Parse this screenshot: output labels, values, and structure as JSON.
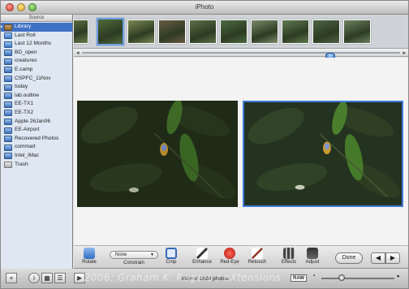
{
  "window": {
    "title": "iPhoto"
  },
  "source": {
    "header": "Source",
    "items": [
      {
        "label": "Library",
        "icon": "library-icon",
        "selected": true
      },
      {
        "label": "Last Roll",
        "icon": "roll-icon"
      },
      {
        "label": "Last 12 Months",
        "icon": "roll-icon"
      },
      {
        "label": "BD_open",
        "icon": "album-icon"
      },
      {
        "label": "creatures",
        "icon": "album-icon"
      },
      {
        "label": "E.camp",
        "icon": "album-icon"
      },
      {
        "label": "CSPFC_11Nov",
        "icon": "album-icon"
      },
      {
        "label": "today",
        "icon": "album-icon"
      },
      {
        "label": "lab.outline",
        "icon": "album-icon"
      },
      {
        "label": "EE-TX1",
        "icon": "album-icon"
      },
      {
        "label": "EE-TX2",
        "icon": "album-icon"
      },
      {
        "label": "Apple 26Jan06",
        "icon": "album-icon"
      },
      {
        "label": "EE-Airport",
        "icon": "album-icon"
      },
      {
        "label": "Recovered Photos",
        "icon": "album-icon"
      },
      {
        "label": "commart",
        "icon": "album-icon"
      },
      {
        "label": "Intel_iMac",
        "icon": "album-icon"
      },
      {
        "label": "Trash",
        "icon": "trash-icon"
      }
    ]
  },
  "filmstrip": {
    "thumbnails": [
      {
        "tone": "#6b7d4a"
      },
      {
        "tone": "#4f6a3a"
      },
      {
        "tone": "#7a8a55"
      },
      {
        "tone": "#6a5a44"
      },
      {
        "tone": "#5c7048"
      },
      {
        "tone": "#4d6b42"
      },
      {
        "tone": "#7a8b6a"
      },
      {
        "tone": "#5f7a50"
      },
      {
        "tone": "#4e6445"
      },
      {
        "tone": "#6b8260"
      }
    ],
    "selected_index": 1
  },
  "edit_toolbar": {
    "rotate": "Rotate",
    "constrain_label": "Constrain",
    "constrain_value": "None",
    "crop": "Crop",
    "enhance": "Enhance",
    "redeye": "Red-Eye",
    "retouch": "Retouch",
    "effects": "Effects",
    "adjust": "Adjust",
    "done": "Done",
    "prev": "◀",
    "next": "▶"
  },
  "bottom_bar": {
    "add": "+",
    "info": "i",
    "photo_count": "1624 of 1624 photos",
    "raw_badge": "RAW",
    "zoom_level": 0.25
  },
  "watermark": "©2006: Graham K. Rogers / eXtensions"
}
